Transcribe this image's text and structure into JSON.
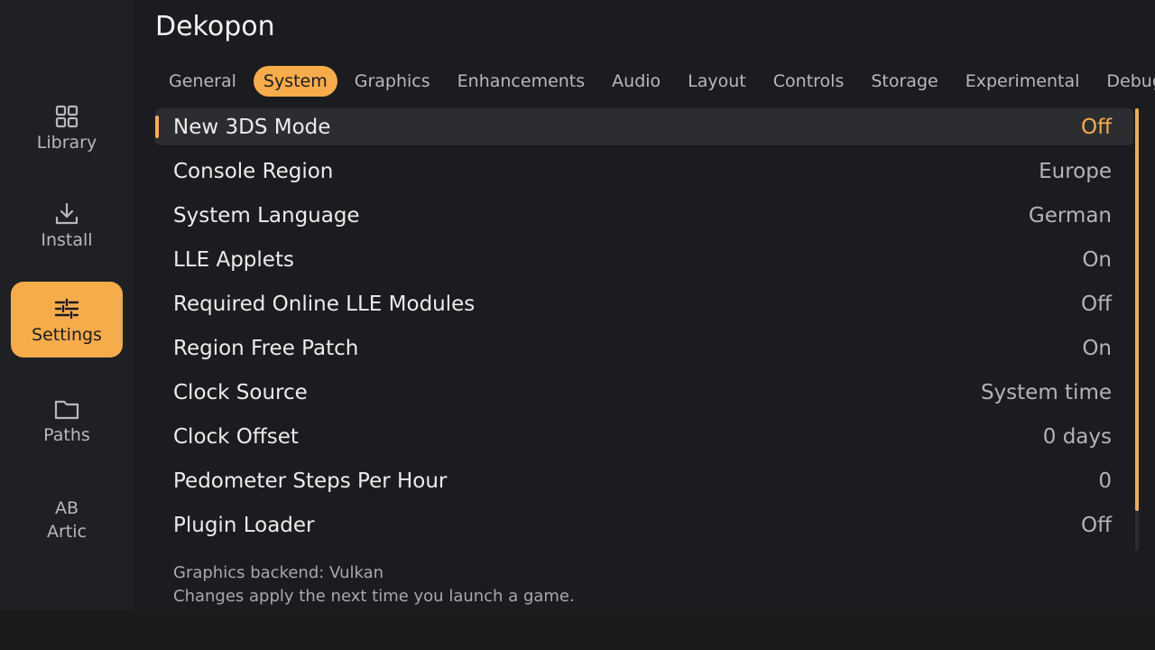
{
  "app": {
    "title": "Dekopon"
  },
  "sidebar": {
    "items": [
      {
        "label": "Library",
        "icon": "grid-icon"
      },
      {
        "label": "Install",
        "icon": "download-icon"
      },
      {
        "label": "Settings",
        "icon": "sliders-icon",
        "active": true
      },
      {
        "label": "Paths",
        "icon": "folder-icon"
      },
      {
        "label": "Artic",
        "icon": "ab-icon",
        "icon_text": "AB"
      }
    ]
  },
  "tabs": [
    {
      "label": "General"
    },
    {
      "label": "System",
      "active": true
    },
    {
      "label": "Graphics"
    },
    {
      "label": "Enhancements"
    },
    {
      "label": "Audio"
    },
    {
      "label": "Layout"
    },
    {
      "label": "Controls"
    },
    {
      "label": "Storage"
    },
    {
      "label": "Experimental"
    },
    {
      "label": "Debug"
    }
  ],
  "settings": [
    {
      "label": "New 3DS Mode",
      "value": "Off"
    },
    {
      "label": "Console Region",
      "value": "Europe"
    },
    {
      "label": "System Language",
      "value": "German"
    },
    {
      "label": "LLE Applets",
      "value": "On"
    },
    {
      "label": "Required Online LLE Modules",
      "value": "Off"
    },
    {
      "label": "Region Free Patch",
      "value": "On"
    },
    {
      "label": "Clock Source",
      "value": "System time"
    },
    {
      "label": "Clock Offset",
      "value": "0 days"
    },
    {
      "label": "Pedometer Steps Per Hour",
      "value": "0"
    },
    {
      "label": "Plugin Loader",
      "value": "Off"
    }
  ],
  "footer": {
    "line1": "Graphics backend: Vulkan",
    "line2": "Changes apply the next time you launch a game."
  },
  "colors": {
    "accent": "#f7ac4b",
    "background": "#1b1c1f",
    "sidebar": "#1f2023",
    "selected_row": "#2c2d31"
  }
}
